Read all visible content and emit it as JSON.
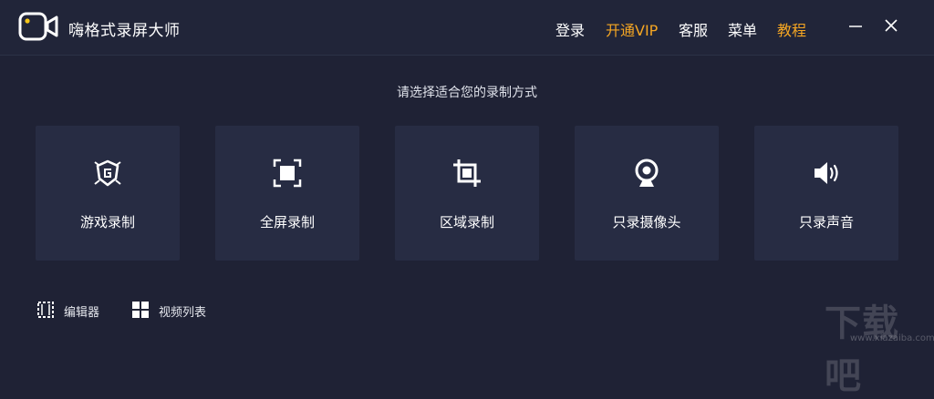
{
  "app": {
    "title": "嗨格式录屏大师"
  },
  "header": {
    "nav": [
      {
        "label": "登录",
        "color": "#ffffff"
      },
      {
        "label": "开通VIP",
        "color": "#f5a623"
      },
      {
        "label": "客服",
        "color": "#ffffff"
      },
      {
        "label": "菜单",
        "color": "#ffffff"
      },
      {
        "label": "教程",
        "color": "#f5a623"
      }
    ]
  },
  "main": {
    "prompt": "请选择适合您的录制方式",
    "cards": [
      {
        "label": "游戏录制",
        "icon": "game-shield-icon"
      },
      {
        "label": "全屏录制",
        "icon": "fullscreen-icon"
      },
      {
        "label": "区域录制",
        "icon": "crop-icon"
      },
      {
        "label": "只录摄像头",
        "icon": "webcam-icon"
      },
      {
        "label": "只录声音",
        "icon": "speaker-icon"
      }
    ]
  },
  "footer": {
    "tools": [
      {
        "label": "编辑器",
        "icon": "editor-icon"
      },
      {
        "label": "视频列表",
        "icon": "grid-icon"
      }
    ]
  },
  "watermark": {
    "text": "下载吧",
    "url": "www.xiazaiba.com"
  },
  "colors": {
    "background": "#1f2235",
    "card": "#272c43",
    "accent": "#f5a623",
    "logo_dot": "#f5c518"
  }
}
